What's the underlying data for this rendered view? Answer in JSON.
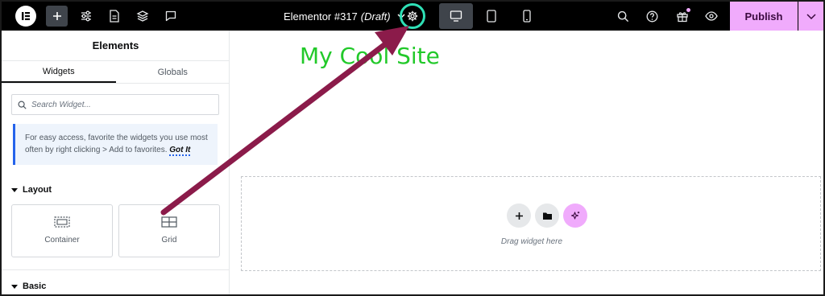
{
  "topbar": {
    "document_title": "Elementor #317",
    "document_status": "(Draft)",
    "publish_label": "Publish"
  },
  "panel": {
    "title": "Elements",
    "tabs": [
      "Widgets",
      "Globals"
    ],
    "search_placeholder": "Search Widget...",
    "notice_text": "For easy access, favorite the widgets you use most often by right clicking > Add to favorites.",
    "notice_link": "Got It",
    "sections": {
      "layout": "Layout",
      "basic": "Basic"
    },
    "widgets": [
      {
        "label": "Container",
        "icon": "container-icon"
      },
      {
        "label": "Grid",
        "icon": "grid-icon"
      }
    ]
  },
  "canvas": {
    "site_title": "My Cool Site",
    "drop_hint": "Drag widget here"
  },
  "colors": {
    "topbar_bg": "#000000",
    "publish_bg": "#f0abfc",
    "highlight_ring": "#2fe0b6",
    "annotation_arrow": "#8b1b4a",
    "site_title": "#22c92a",
    "notice_accent": "#2563eb"
  }
}
